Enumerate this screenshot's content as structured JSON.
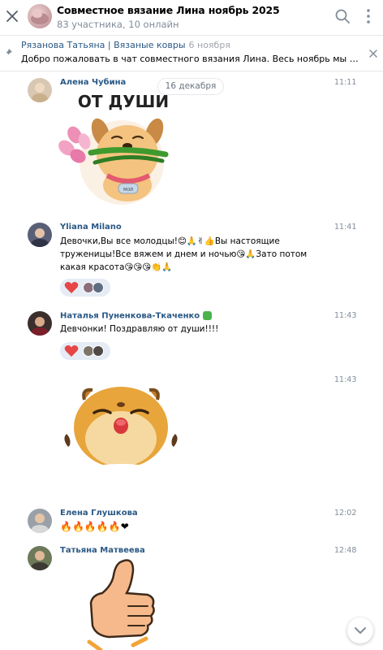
{
  "header": {
    "title": "Совместное вязание Лина ноябрь 2025",
    "subtitle": "83 участника, 10 онлайн"
  },
  "pinned": {
    "author": "Рязанова Татьяна | Вязаные ковры",
    "time": "6 ноября",
    "text": "Добро пожаловать в чат совместного вязания Лина. Весь ноябрь мы буде..."
  },
  "date_separator": "16 декабря",
  "messages": [
    {
      "author": "Алена Чубина",
      "time": "11:11",
      "sticker_caption": "ОТ ДУШИ",
      "collar_tag": "МОЙ"
    },
    {
      "author": "Yliana Milano",
      "time": "11:41",
      "lines": [
        "Девочки,Вы все молодцы!😊🙏✌👍Вы настоящие",
        "труженицы!Все вяжем и днем и ночью😘🙏Зато потом",
        "какая красота😘😘😘👏🙏"
      ]
    },
    {
      "author": "Наталья Пуненкова-Ткаченко",
      "time": "11:43",
      "text": "Девчонки! Поздравляю от души!!!!"
    },
    {
      "author": "",
      "time": "11:43"
    },
    {
      "author": "Елена Глушкова",
      "time": "12:02",
      "text": "🔥🔥🔥🔥🔥❤"
    },
    {
      "author": "Татьяна Матвеева",
      "time": "12:48"
    }
  ],
  "colors": {
    "author_link": "#2a5885",
    "meta_gray": "#818c99",
    "reaction_bg": "#e5ecf5",
    "heart": "#e64646"
  }
}
